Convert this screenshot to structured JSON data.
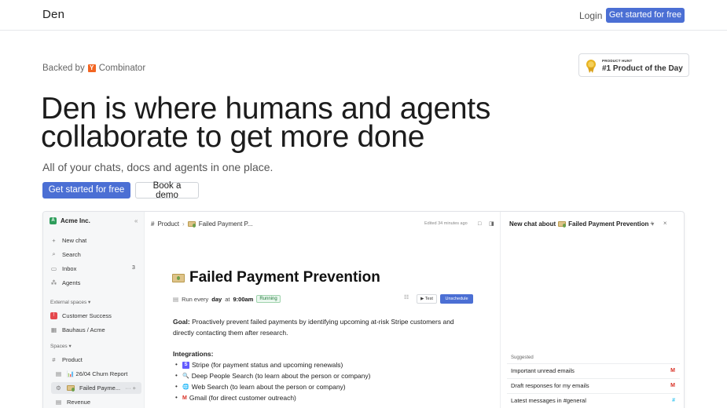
{
  "nav": {
    "logo": "Den",
    "login": "Login",
    "cta": "Get started for free"
  },
  "hero": {
    "backed_prefix": "Backed by",
    "yc_letter": "Y",
    "backed_suffix": "Combinator",
    "badge_small": "PRODUCT HUNT",
    "badge_big": "#1 Product of the Day",
    "headline_line1": "Den is where humans and agents",
    "headline_line2": "collaborate to get more done",
    "subtitle": "All of your chats, docs and agents in one place.",
    "primary_cta": "Get started for free",
    "secondary_cta_line1": "Book a",
    "secondary_cta_line2": "demo"
  },
  "app": {
    "sidebar": {
      "workspace_badge": "A",
      "workspace": "Acme Inc.",
      "collapse": "«",
      "items": [
        {
          "icon": "+",
          "label": "New chat"
        },
        {
          "icon": "⌕",
          "label": "Search"
        },
        {
          "icon": "▭",
          "label": "Inbox",
          "count": "3"
        },
        {
          "icon": "⁂",
          "label": "Agents"
        }
      ],
      "external_label": "External spaces ▾",
      "external": [
        {
          "badge": "!",
          "label": "Customer Success"
        },
        {
          "icon": "▦",
          "label": "Bauhaus / Acme"
        }
      ],
      "spaces_label": "Spaces ▾",
      "spaces": [
        {
          "icon": "#",
          "label": "Product"
        }
      ],
      "docs": [
        {
          "icon": "▤",
          "label": "📊 26/04 Churn Report"
        },
        {
          "icon": "⚙",
          "label": "Failed Payme...",
          "actions": "··· +"
        },
        {
          "icon": "▤",
          "label": "Revenue"
        }
      ]
    },
    "doc": {
      "crumb_hash": "#",
      "crumb_space": "Product",
      "crumb_sep": "›",
      "crumb_doc": "Failed Payment P...",
      "edited": "Edited 34 minutes ago",
      "icons": "□ ◨",
      "title": "Failed Payment Prevention",
      "run_prefix": "Run every",
      "run_freq": "day",
      "run_at": "at",
      "run_time": "9:00am",
      "status": "Running",
      "settings_icon": "☷",
      "test": "▶ Test",
      "unschedule": "Unschedule",
      "goal_label": "Goal:",
      "goal_text": " Proactively prevent failed payments by identifying upcoming at-risk Stripe customers and directly contacting them after research.",
      "integrations_title": "Integrations:",
      "integrations": [
        {
          "icon": "S",
          "label": "Stripe (for payment status and upcoming renewals)"
        },
        {
          "icon": "🔍",
          "label": "Deep People Search (to learn about the person or company)"
        },
        {
          "icon": "🌐",
          "label": "Web Search (to learn about the person or company)"
        },
        {
          "icon": "M",
          "label": "Gmail (for direct customer outreach)"
        }
      ],
      "bullet": "•"
    },
    "chat": {
      "title_prefix": "New chat about",
      "title_doc": "Failed Payment Prevention",
      "title_caret": "▾",
      "controls": "+ ×",
      "suggested_label": "Suggested",
      "suggestions": [
        {
          "label": "Important unread emails",
          "app": "M"
        },
        {
          "label": "Draft responses for my emails",
          "app": "M"
        },
        {
          "label": "Latest messages in #general",
          "app": "#"
        }
      ]
    }
  },
  "colors": {
    "accent": "#4b6fd4",
    "running": "#1f7a3a",
    "yc": "#f26522"
  }
}
